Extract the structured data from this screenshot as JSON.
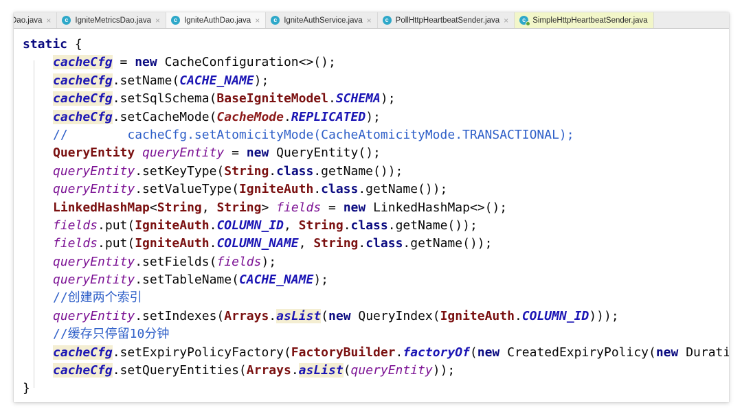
{
  "tabs": [
    {
      "label": "Dao.java",
      "icon": "c",
      "active": false
    },
    {
      "label": "IgniteMetricsDao.java",
      "icon": "c",
      "active": false
    },
    {
      "label": "IgniteAuthDao.java",
      "icon": "c",
      "active": true
    },
    {
      "label": "IgniteAuthService.java",
      "icon": "c",
      "active": false
    },
    {
      "label": "PollHttpHeartbeatSender.java",
      "icon": "c",
      "active": false
    },
    {
      "label": "SimpleHttpHeartbeatSender.java",
      "icon": "c",
      "active": false
    }
  ],
  "close_glyph": "×",
  "code_lines": [
    [
      [
        "kw",
        "static"
      ],
      [
        "plain",
        " {"
      ]
    ],
    [
      [
        "ind",
        ""
      ],
      [
        "stfld-hl",
        "cacheCfg"
      ],
      [
        "plain",
        " = "
      ],
      [
        "kw",
        "new"
      ],
      [
        "plain",
        " CacheConfiguration<>();"
      ]
    ],
    [
      [
        "ind",
        ""
      ],
      [
        "stfld-hl",
        "cacheCfg"
      ],
      [
        "plain",
        ".setName("
      ],
      [
        "const",
        "CACHE_NAME"
      ],
      [
        "plain",
        ");"
      ]
    ],
    [
      [
        "ind",
        ""
      ],
      [
        "stfld-hl",
        "cacheCfg"
      ],
      [
        "plain",
        ".setSqlSchema("
      ],
      [
        "cls",
        "BaseIgniteModel"
      ],
      [
        "plain",
        "."
      ],
      [
        "const",
        "SCHEMA"
      ],
      [
        "plain",
        ");"
      ]
    ],
    [
      [
        "ind",
        ""
      ],
      [
        "stfld-hl",
        "cacheCfg"
      ],
      [
        "plain",
        ".setCacheMode("
      ],
      [
        "enumc",
        "CacheMode"
      ],
      [
        "plain",
        "."
      ],
      [
        "const",
        "REPLICATED"
      ],
      [
        "plain",
        ");"
      ]
    ],
    [
      [
        "ind",
        ""
      ],
      [
        "cmt",
        "//        cacheCfg.setAtomicityMode(CacheAtomicityMode.TRANSACTIONAL);"
      ]
    ],
    [
      [
        "ind",
        ""
      ],
      [
        "cls",
        "QueryEntity"
      ],
      [
        "plain",
        " "
      ],
      [
        "lv",
        "queryEntity"
      ],
      [
        "plain",
        " = "
      ],
      [
        "kw",
        "new"
      ],
      [
        "plain",
        " QueryEntity();"
      ]
    ],
    [
      [
        "ind",
        ""
      ],
      [
        "lv",
        "queryEntity"
      ],
      [
        "plain",
        ".setKeyType("
      ],
      [
        "cls",
        "String"
      ],
      [
        "plain",
        "."
      ],
      [
        "kw",
        "class"
      ],
      [
        "plain",
        ".getName());"
      ]
    ],
    [
      [
        "ind",
        ""
      ],
      [
        "lv",
        "queryEntity"
      ],
      [
        "plain",
        ".setValueType("
      ],
      [
        "cls",
        "IgniteAuth"
      ],
      [
        "plain",
        "."
      ],
      [
        "kw",
        "class"
      ],
      [
        "plain",
        ".getName());"
      ]
    ],
    [
      [
        "ind",
        ""
      ],
      [
        "cls",
        "LinkedHashMap"
      ],
      [
        "plain",
        "<"
      ],
      [
        "cls",
        "String"
      ],
      [
        "plain",
        ", "
      ],
      [
        "cls",
        "String"
      ],
      [
        "plain",
        "> "
      ],
      [
        "lv",
        "fields"
      ],
      [
        "plain",
        " = "
      ],
      [
        "kw",
        "new"
      ],
      [
        "plain",
        " LinkedHashMap<>();"
      ]
    ],
    [
      [
        "ind",
        ""
      ],
      [
        "lv",
        "fields"
      ],
      [
        "plain",
        ".put("
      ],
      [
        "cls",
        "IgniteAuth"
      ],
      [
        "plain",
        "."
      ],
      [
        "const",
        "COLUMN_ID"
      ],
      [
        "plain",
        ", "
      ],
      [
        "cls",
        "String"
      ],
      [
        "plain",
        "."
      ],
      [
        "kw",
        "class"
      ],
      [
        "plain",
        ".getName());"
      ]
    ],
    [
      [
        "ind",
        ""
      ],
      [
        "lv",
        "fields"
      ],
      [
        "plain",
        ".put("
      ],
      [
        "cls",
        "IgniteAuth"
      ],
      [
        "plain",
        "."
      ],
      [
        "const",
        "COLUMN_NAME"
      ],
      [
        "plain",
        ", "
      ],
      [
        "cls",
        "String"
      ],
      [
        "plain",
        "."
      ],
      [
        "kw",
        "class"
      ],
      [
        "plain",
        ".getName());"
      ]
    ],
    [
      [
        "ind",
        ""
      ],
      [
        "lv",
        "queryEntity"
      ],
      [
        "plain",
        ".setFields("
      ],
      [
        "lv",
        "fields"
      ],
      [
        "plain",
        ");"
      ]
    ],
    [
      [
        "ind",
        ""
      ],
      [
        "lv",
        "queryEntity"
      ],
      [
        "plain",
        ".setTableName("
      ],
      [
        "const",
        "CACHE_NAME"
      ],
      [
        "plain",
        ");"
      ]
    ],
    [
      [
        "ind",
        ""
      ],
      [
        "cmt",
        "//创建两个索引"
      ]
    ],
    [
      [
        "ind",
        ""
      ],
      [
        "lv",
        "queryEntity"
      ],
      [
        "plain",
        ".setIndexes("
      ],
      [
        "cls",
        "Arrays"
      ],
      [
        "plain",
        "."
      ],
      [
        "smeth-hl",
        "asList"
      ],
      [
        "plain",
        "("
      ],
      [
        "kw",
        "new"
      ],
      [
        "plain",
        " QueryIndex("
      ],
      [
        "cls",
        "IgniteAuth"
      ],
      [
        "plain",
        "."
      ],
      [
        "const",
        "COLUMN_ID"
      ],
      [
        "plain",
        ")));"
      ]
    ],
    [
      [
        "ind",
        ""
      ],
      [
        "cmt",
        "//缓存只停留10分钟"
      ]
    ],
    [
      [
        "ind",
        ""
      ],
      [
        "stfld-hl",
        "cacheCfg"
      ],
      [
        "plain",
        ".setExpiryPolicyFactory("
      ],
      [
        "cls",
        "FactoryBuilder"
      ],
      [
        "plain",
        "."
      ],
      [
        "const",
        "factoryOf"
      ],
      [
        "plain",
        "("
      ],
      [
        "kw",
        "new"
      ],
      [
        "plain",
        " CreatedExpiryPolicy("
      ],
      [
        "kw",
        "new"
      ],
      [
        "plain",
        " Duratio"
      ]
    ],
    [
      [
        "ind",
        ""
      ],
      [
        "stfld-hl",
        "cacheCfg"
      ],
      [
        "plain",
        ".setQueryEntities("
      ],
      [
        "cls",
        "Arrays"
      ],
      [
        "plain",
        "."
      ],
      [
        "smeth-hl",
        "asList"
      ],
      [
        "plain",
        "("
      ],
      [
        "lv",
        "queryEntity"
      ],
      [
        "plain",
        "));"
      ]
    ],
    [
      [
        "plain",
        "}"
      ]
    ]
  ]
}
